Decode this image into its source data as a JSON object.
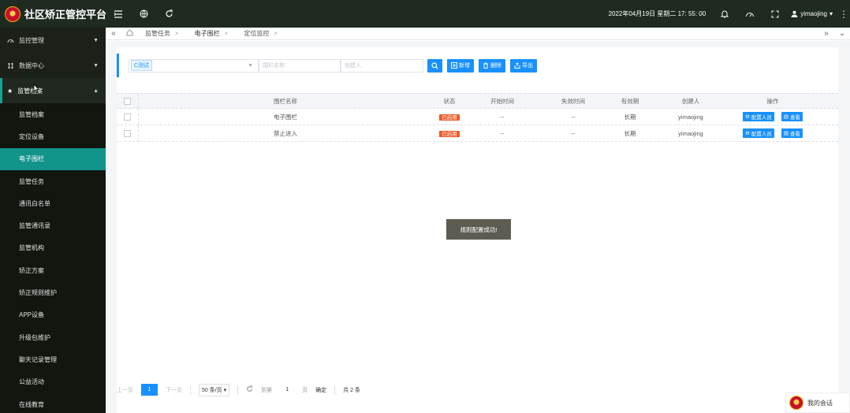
{
  "app": {
    "title": "社区矫正管控平台"
  },
  "header": {
    "datetime": "2022年04月19日 星期二 17: 55: 00",
    "username": "yimaojing"
  },
  "sidebar": {
    "groups": [
      {
        "label": "监控管理",
        "icon": "dashboard-icon"
      },
      {
        "label": "数据中心",
        "icon": "data-icon"
      },
      {
        "label": "监管档案",
        "icon": "star-icon"
      }
    ],
    "items": [
      {
        "label": "监管档案"
      },
      {
        "label": "定位设备"
      },
      {
        "label": "电子围栏"
      },
      {
        "label": "监管任务"
      },
      {
        "label": "通讯白名单"
      },
      {
        "label": "监管通讯录"
      },
      {
        "label": "监管机构"
      },
      {
        "label": "矫正方案"
      },
      {
        "label": "矫正规则维护"
      },
      {
        "label": "APP设备"
      },
      {
        "label": "升级包维护"
      },
      {
        "label": "聊天记录管理"
      },
      {
        "label": "公益活动"
      },
      {
        "label": "在线教育"
      }
    ]
  },
  "tabs": [
    {
      "label": "监管任务"
    },
    {
      "label": "电子围栏"
    },
    {
      "label": "定位监控"
    }
  ],
  "toolbar": {
    "selected_tag": "C测试",
    "name_placeholder": "围栏名称",
    "creator_placeholder": "创建人",
    "add_label": "新增",
    "delete_label": "删除",
    "export_label": "导出"
  },
  "table": {
    "columns": [
      "围栏名称",
      "状态",
      "开始时间",
      "失效时间",
      "有效期",
      "创建人",
      "操作"
    ],
    "rows": [
      {
        "name": "电子围栏",
        "status": "已启用",
        "start": "--",
        "end": "--",
        "validity": "长期",
        "creator": "yimaojing"
      },
      {
        "name": "禁止进入",
        "status": "已启用",
        "start": "--",
        "end": "--",
        "validity": "长期",
        "creator": "yimaojing"
      }
    ],
    "op_assign_label": "配置人员",
    "op_view_label": "查看"
  },
  "toast": {
    "message": "规则配置成功!"
  },
  "pagination": {
    "prev": "上一页",
    "current": "1",
    "next": "下一页",
    "page_size": "50 条/页",
    "goto_prefix": "到第",
    "goto_value": "1",
    "goto_suffix": "页",
    "confirm": "确定",
    "total": "共 2 条"
  },
  "chat": {
    "label": "我的会话"
  },
  "colors": {
    "header_bg": "#1f2a20",
    "sidebar_bg": "#1b2119",
    "active_item": "#12948a",
    "primary": "#1890ff",
    "status_enabled": "#f05a28"
  }
}
